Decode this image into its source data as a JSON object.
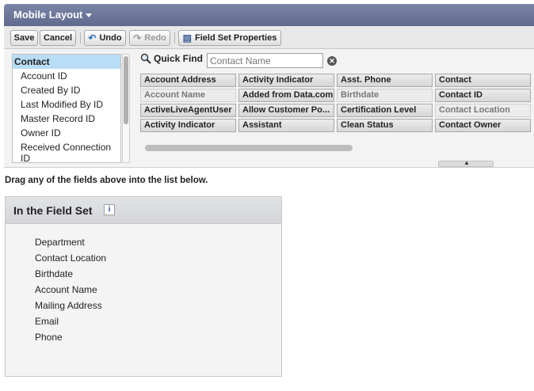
{
  "header": {
    "title": "Mobile Layout"
  },
  "toolbar": {
    "save": "Save",
    "cancel": "Cancel",
    "undo": "Undo",
    "redo": "Redo",
    "field_set_properties": "Field Set Properties"
  },
  "objects": {
    "items": [
      "Contact",
      "Account ID",
      "Created By ID",
      "Last Modified By ID",
      "Master Record ID",
      "Owner ID",
      "Received Connection",
      "ID"
    ],
    "selected": "Contact"
  },
  "quick_find": {
    "label": "Quick Find",
    "placeholder": "Contact Name"
  },
  "fields": [
    [
      "Account Address",
      "Activity Indicator",
      "Asst. Phone",
      "Contact"
    ],
    [
      "Account Name",
      "Added from Data.com",
      "Birthdate",
      "Contact ID"
    ],
    [
      "ActiveLiveAgentUser",
      "Allow Customer Po...",
      "Certification Level",
      "Contact Location"
    ],
    [
      "Activity Indicator",
      "Assistant",
      "Clean Status",
      "Contact Owner"
    ]
  ],
  "instruction": "Drag any of the fields above into the list below.",
  "field_set": {
    "title": "In the Field Set",
    "info_icon": "i",
    "items": [
      "Department",
      "Contact Location",
      "Birthdate",
      "Account Name",
      "Mailing Address",
      "Email",
      "Phone"
    ]
  }
}
